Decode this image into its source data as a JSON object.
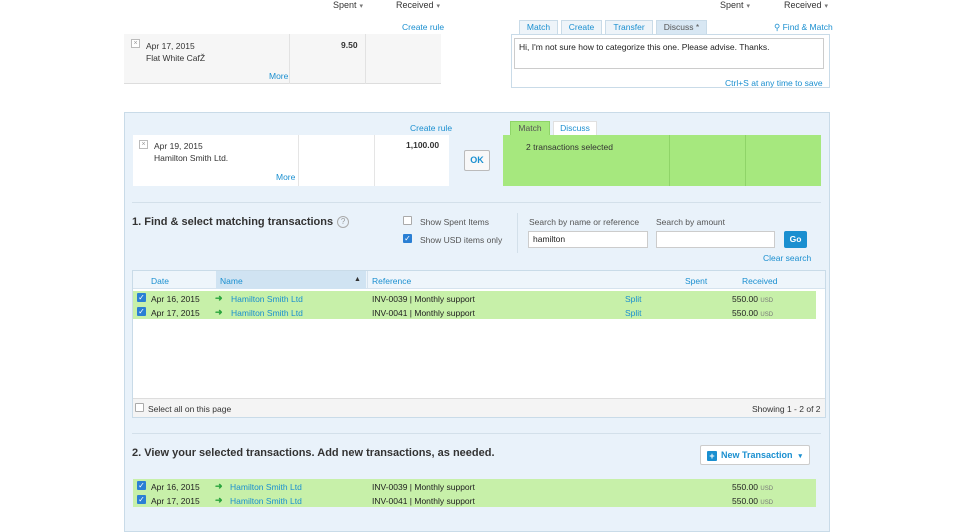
{
  "columns": {
    "spent": "Spent",
    "received": "Received"
  },
  "top_statement": {
    "date": "Apr 17, 2015",
    "payee": "Flat White CafŽ",
    "spent": "9.50",
    "more": "More",
    "create_rule": "Create rule"
  },
  "top_tabs": [
    {
      "label": "Match"
    },
    {
      "label": "Create"
    },
    {
      "label": "Transfer"
    },
    {
      "label": "Discuss *"
    }
  ],
  "find_match": "Find & Match",
  "discuss_message": "Hi, I'm not sure how to categorize this one. Please advise. Thanks.",
  "save_hint": "Ctrl+S at any time to save",
  "statement2": {
    "date": "Apr 19, 2015",
    "payee": "Hamilton Smith Ltd.",
    "spent": "1,100.00",
    "more": "More",
    "create_rule": "Create rule",
    "ok": "OK"
  },
  "match_tabs": [
    {
      "label": "Match"
    },
    {
      "label": "Discuss"
    }
  ],
  "selected_summary": "2 transactions selected",
  "section1": {
    "title": "1. Find & select matching transactions",
    "help": "?",
    "show_spent": "Show Spent Items",
    "show_usd": "Show USD items only",
    "search_name_label": "Search by name or reference",
    "search_name_value": "hamilton",
    "search_amount_label": "Search by amount",
    "search_amount_value": "",
    "go": "Go",
    "clear": "Clear search"
  },
  "table": {
    "headers": {
      "date": "Date",
      "name": "Name",
      "reference": "Reference",
      "spent": "Spent",
      "received": "Received"
    },
    "sort_indicator": "▲",
    "rows": [
      {
        "date": "Apr 16, 2015",
        "name": "Hamilton Smith Ltd",
        "reference": "INV-0039 | Monthly support",
        "split": "Split",
        "received": "550.00",
        "currency": "USD"
      },
      {
        "date": "Apr 17, 2015",
        "name": "Hamilton Smith Ltd",
        "reference": "INV-0041 | Monthly support",
        "split": "Split",
        "received": "550.00",
        "currency": "USD"
      }
    ],
    "select_all": "Select all on this page",
    "showing": "Showing 1 - 2 of 2"
  },
  "section2": {
    "title": "2. View your selected transactions. Add new transactions, as needed.",
    "new_transaction": "New Transaction",
    "rows": [
      {
        "date": "Apr 16, 2015",
        "name": "Hamilton Smith Ltd",
        "reference": "INV-0039 | Monthly support",
        "received": "550.00",
        "currency": "USD"
      },
      {
        "date": "Apr 17, 2015",
        "name": "Hamilton Smith Ltd",
        "reference": "INV-0041 | Monthly support",
        "received": "550.00",
        "currency": "USD"
      }
    ]
  }
}
